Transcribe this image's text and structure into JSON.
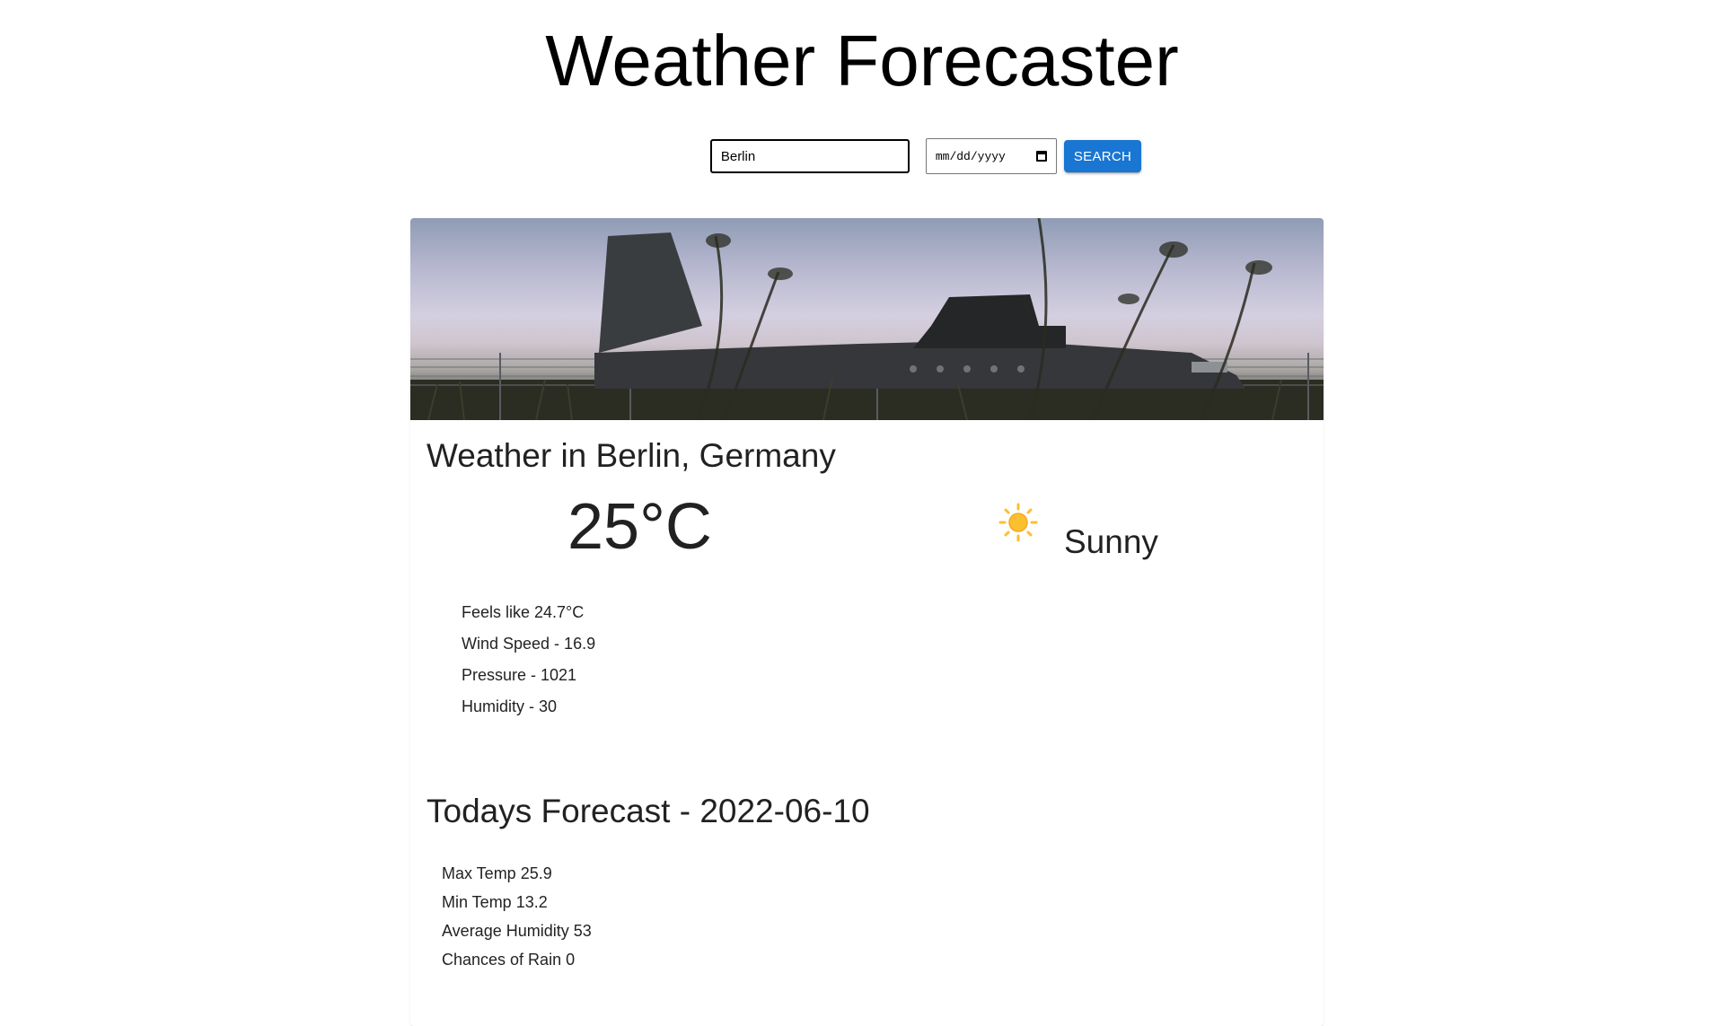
{
  "header": {
    "title": "Weather Forecaster"
  },
  "search": {
    "city_value": "Berlin",
    "date_placeholder": "mm/dd/yyyy",
    "button_label": "SEARCH"
  },
  "current": {
    "heading": "Weather in Berlin, Germany",
    "temperature": "25°C",
    "condition": "Sunny",
    "condition_icon": "sun-icon",
    "details": [
      "Feels like 24.7°C",
      "Wind Speed - 16.9",
      "Pressure - 1021",
      "Humidity - 30"
    ]
  },
  "forecast": {
    "heading": "Todays Forecast - 2022-06-10",
    "items": [
      "Max Temp 25.9",
      "Min Temp 13.2",
      "Average Humidity 53",
      "Chances of Rain 0"
    ]
  },
  "colors": {
    "accent": "#1976d2",
    "sun": "#fbc02d"
  }
}
